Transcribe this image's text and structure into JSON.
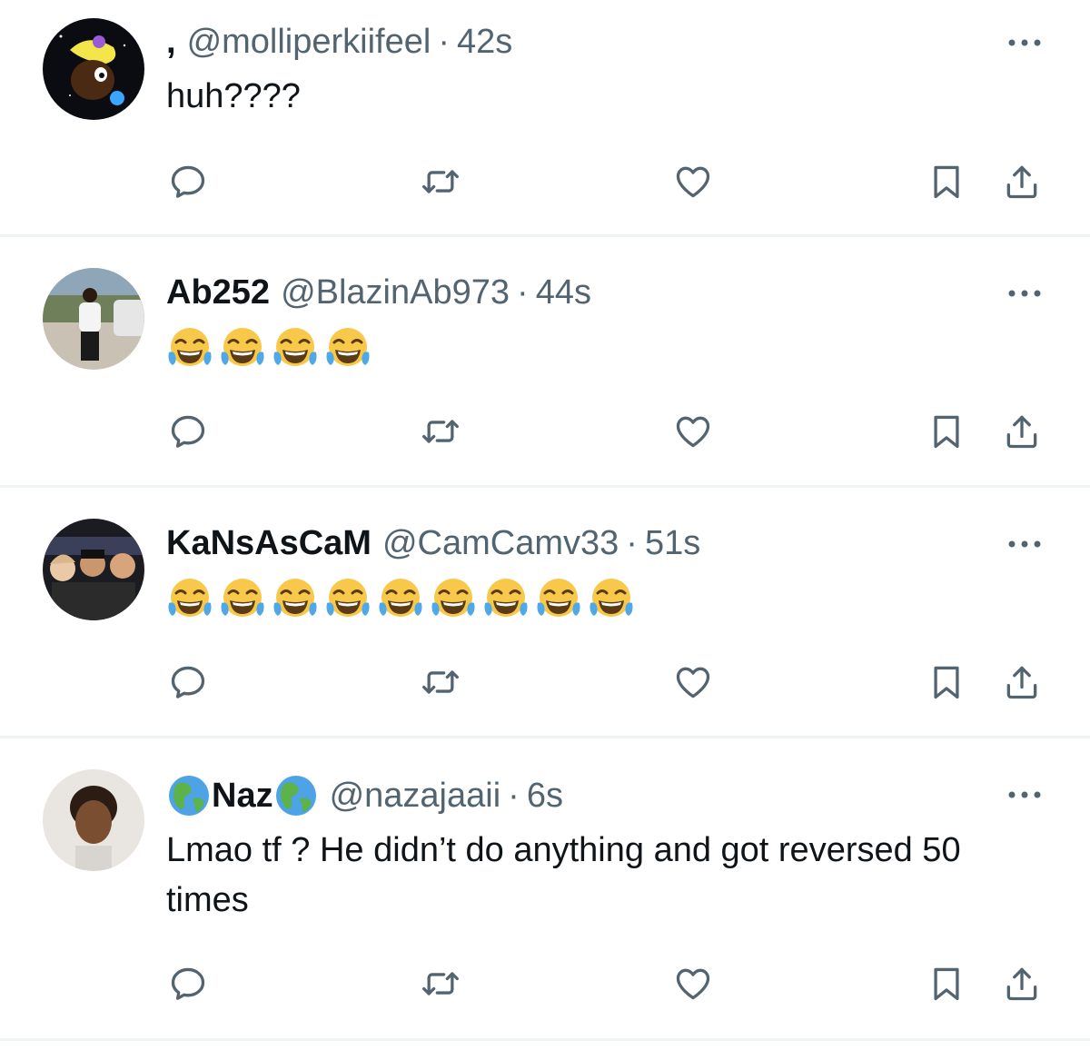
{
  "colors": {
    "text": "#0f1419",
    "secondary": "#536471",
    "divider": "#eff3f4",
    "emoji_face": "#f7c84a",
    "emoji_tear": "#4fa8e8"
  },
  "icons": {
    "reply": "reply-icon",
    "retweet": "retweet-icon",
    "like": "heart-icon",
    "bookmark": "bookmark-icon",
    "share": "share-icon",
    "more": "more-icon"
  },
  "tweets": [
    {
      "display_name": ",",
      "handle": "@molliperkiifeel",
      "separator": "·",
      "time": "42s",
      "text": "huh????",
      "emoji_count": 0,
      "emoji": "face-with-tears-of-joy"
    },
    {
      "display_name": "Ab252",
      "handle": "@BlazinAb973",
      "separator": "·",
      "time": "44s",
      "text": "",
      "emoji_count": 4,
      "emoji": "face-with-tears-of-joy"
    },
    {
      "display_name": "KaNsAsCaM",
      "handle": "@CamCamv33",
      "separator": "·",
      "time": "51s",
      "text": "",
      "emoji_count": 9,
      "emoji": "face-with-tears-of-joy"
    },
    {
      "display_name": "Naz",
      "display_name_emoji": "globe-emoji",
      "handle": "@nazajaaii",
      "separator": "·",
      "time": "6s",
      "text": "Lmao tf ? He didn’t do anything and got reversed 50 times",
      "emoji_count": 0,
      "emoji": "face-with-tears-of-joy"
    }
  ]
}
